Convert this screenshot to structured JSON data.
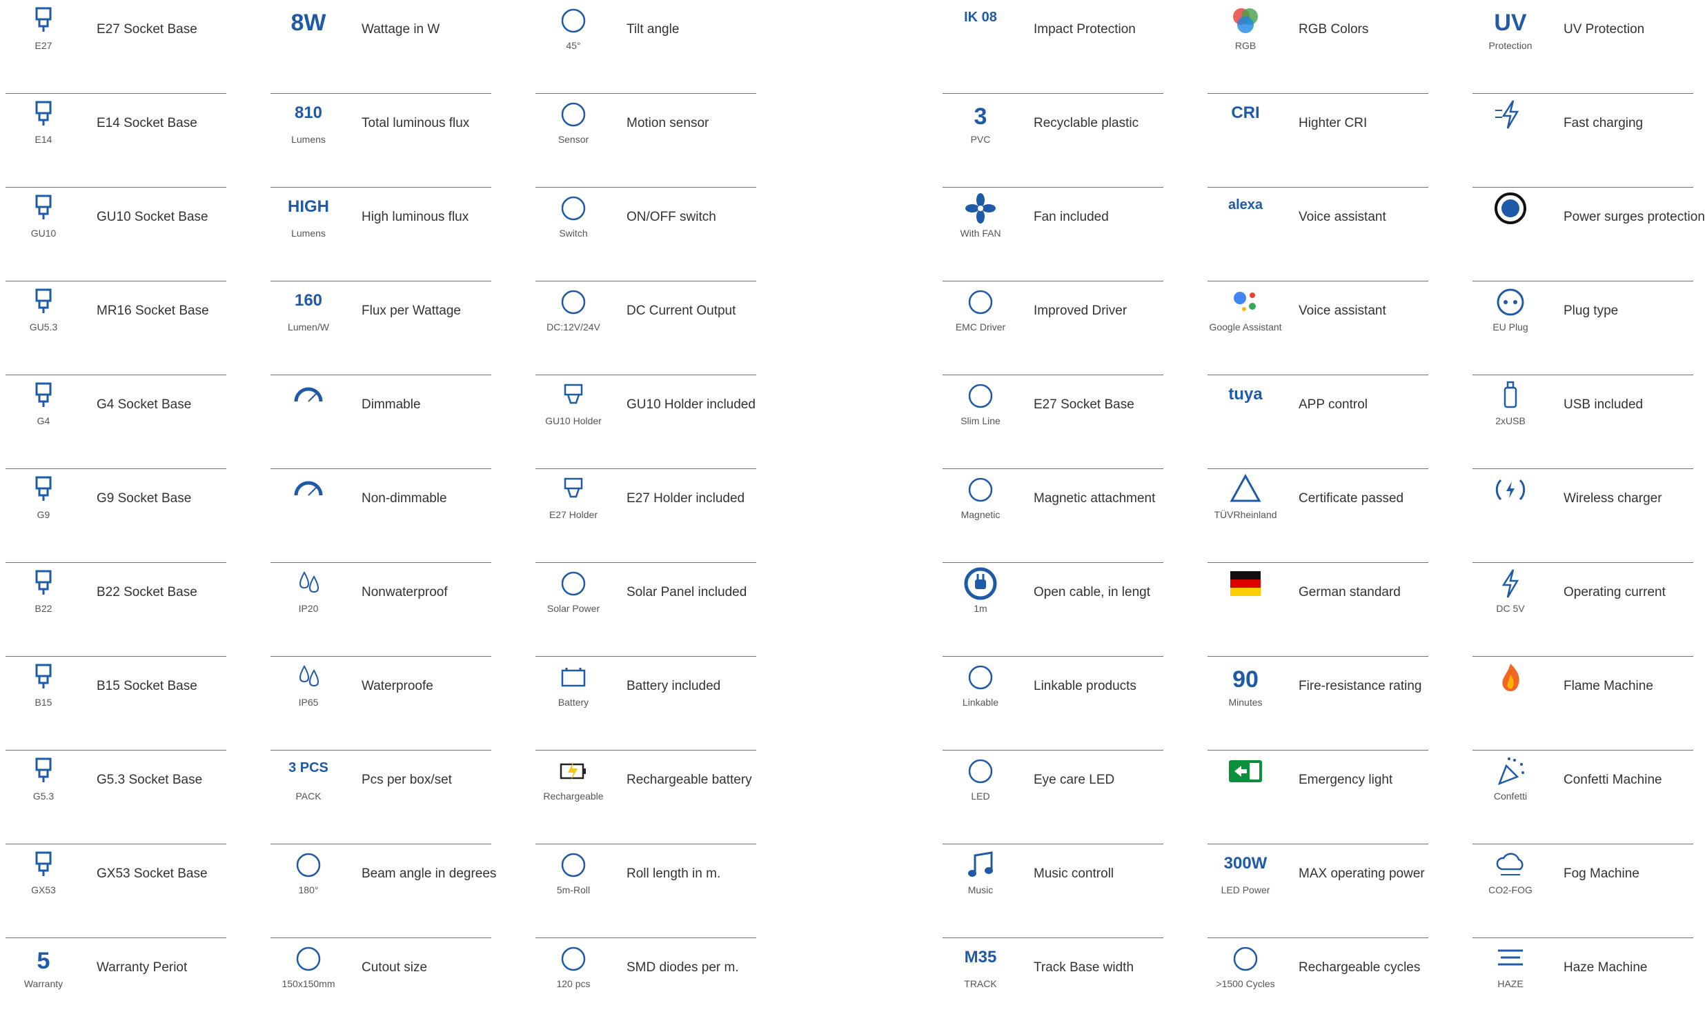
{
  "columns": [
    [
      {
        "icon": "socket-base-icon",
        "sub": "E27",
        "label": "E27 Socket Base"
      },
      {
        "icon": "socket-base-icon",
        "sub": "E14",
        "label": "E14 Socket Base"
      },
      {
        "icon": "socket-base-icon",
        "sub": "GU10",
        "label": "GU10 Socket Base"
      },
      {
        "icon": "socket-base-icon",
        "sub": "GU5.3",
        "label": "MR16 Socket Base"
      },
      {
        "icon": "socket-base-icon",
        "sub": "G4",
        "label": "G4 Socket Base"
      },
      {
        "icon": "socket-base-icon",
        "sub": "G9",
        "label": "G9 Socket Base"
      },
      {
        "icon": "socket-base-icon",
        "sub": "B22",
        "label": "B22 Socket Base"
      },
      {
        "icon": "socket-base-icon",
        "sub": "B15",
        "label": "B15 Socket Base"
      },
      {
        "icon": "socket-base-icon",
        "sub": "G5.3",
        "label": "G5.3 Socket Base"
      },
      {
        "icon": "socket-base-icon",
        "sub": "GX53",
        "label": "GX53 Socket Base"
      },
      {
        "icon": "warranty-icon",
        "big": "5",
        "sub": "Warranty",
        "label": "Warranty Periot"
      }
    ],
    [
      {
        "icon": "wattage-icon",
        "big": "8W",
        "label": "Wattage in W"
      },
      {
        "icon": "sun-icon",
        "big": "810",
        "sub": "Lumens",
        "label": "Total luminous flux"
      },
      {
        "icon": "sun-icon",
        "big": "HIGH",
        "sub": "Lumens",
        "label": "High luminous flux"
      },
      {
        "icon": "sun-icon",
        "big": "160",
        "sub": "Lumen/W",
        "label": "Flux per Wattage"
      },
      {
        "icon": "dimmer-icon",
        "label": "Dimmable"
      },
      {
        "icon": "dimmer-icon",
        "label": "Non-dimmable"
      },
      {
        "icon": "drop-icon",
        "sub": "IP20",
        "label": "Nonwaterproof"
      },
      {
        "icon": "drop-icon",
        "sub": "IP65",
        "label": "Waterproofe"
      },
      {
        "icon": "box-icon",
        "big": "3 PCS",
        "sub": "PACK",
        "label": "Pcs per box/set"
      },
      {
        "icon": "beam-angle-icon",
        "sub": "180°",
        "label": "Beam angle in degrees"
      },
      {
        "icon": "cutout-icon",
        "sub": "150x150mm",
        "label": "Cutout size"
      }
    ],
    [
      {
        "icon": "tilt-icon",
        "sub": "45°",
        "label": "Tilt angle"
      },
      {
        "icon": "motion-sensor-icon",
        "sub": "Sensor",
        "label": "Motion sensor"
      },
      {
        "icon": "switch-icon",
        "sub": "Switch",
        "label": "ON/OFF switch"
      },
      {
        "icon": "dc-icon",
        "sub": "DC:12V/24V",
        "label": "DC Current Output"
      },
      {
        "icon": "holder-icon",
        "sub": "GU10 Holder",
        "label": "GU10 Holder included"
      },
      {
        "icon": "holder-icon",
        "sub": "E27 Holder",
        "label": "E27 Holder included"
      },
      {
        "icon": "solar-icon",
        "sub": "Solar Power",
        "label": "Solar Panel included"
      },
      {
        "icon": "battery-icon",
        "sub": "Battery",
        "label": "Battery included"
      },
      {
        "icon": "battery-charge-icon",
        "sub": "Rechargeable",
        "label": "Rechargeable battery"
      },
      {
        "icon": "roll-icon",
        "sub": "5m-Roll",
        "label": "Roll length in m."
      },
      {
        "icon": "smd-icon",
        "sub": "120 pcs",
        "label": "SMD diodes per m."
      }
    ],
    [
      {
        "icon": "ik08-icon",
        "big": "IK 08",
        "label": "Impact Protection"
      },
      {
        "icon": "recycle-icon",
        "big": "3",
        "sub": "PVC",
        "label": "Recyclable plastic"
      },
      {
        "icon": "fan-icon",
        "sub": "With FAN",
        "label": "Fan included"
      },
      {
        "icon": "driver-icon",
        "sub": "EMC Driver",
        "label": "Improved Driver"
      },
      {
        "icon": "slim-icon",
        "sub": "Slim Line",
        "label": "E27 Socket Base"
      },
      {
        "icon": "magnet-icon",
        "sub": "Magnetic",
        "label": "Magnetic attachment"
      },
      {
        "icon": "plug-icon",
        "sub": "1m",
        "label": "Open cable, in lengt"
      },
      {
        "icon": "connector-icon",
        "sub": "Linkable",
        "label": "Linkable products"
      },
      {
        "icon": "eye-icon",
        "sub": "LED",
        "label": "Eye care LED"
      },
      {
        "icon": "music-icon",
        "sub": "Music",
        "label": "Music controll"
      },
      {
        "icon": "track-icon",
        "big": "M35",
        "sub": "TRACK",
        "label": "Track Base width"
      }
    ],
    [
      {
        "icon": "rgb-icon",
        "sub": "RGB",
        "label": "RGB Colors"
      },
      {
        "icon": "cri-icon",
        "big": "CRI",
        "label": "Highter CRI"
      },
      {
        "icon": "alexa-icon",
        "big": "alexa",
        "label": "Voice assistant"
      },
      {
        "icon": "google-assistant-icon",
        "sub": "Google Assistant",
        "label": "Voice assistant"
      },
      {
        "icon": "tuya-icon",
        "big": "tuya",
        "label": "APP control"
      },
      {
        "icon": "tuv-icon",
        "sub": "TÜVRheinland",
        "label": "Certificate passed"
      },
      {
        "icon": "german-flag-icon",
        "label": "German standard"
      },
      {
        "icon": "fire-icon",
        "big": "90",
        "sub": "Minutes",
        "label": "Fire-resistance rating"
      },
      {
        "icon": "exit-icon",
        "label": "Emergency light"
      },
      {
        "icon": "power-icon",
        "big": "300W",
        "sub": "LED Power",
        "label": "MAX operating power"
      },
      {
        "icon": "battery-cycle-icon",
        "sub": ">1500 Cycles",
        "label": "Rechargeable cycles"
      }
    ],
    [
      {
        "icon": "uv-icon",
        "big": "UV",
        "sub": "Protection",
        "label": "UV Protection"
      },
      {
        "icon": "fast-charge-icon",
        "label": "Fast charging"
      },
      {
        "icon": "surge-icon",
        "label": "Power surges protection"
      },
      {
        "icon": "eu-plug-icon",
        "sub": "EU Plug",
        "label": "Plug type"
      },
      {
        "icon": "usb-icon",
        "sub": "2xUSB",
        "label": "USB included"
      },
      {
        "icon": "wireless-icon",
        "label": "Wireless charger"
      },
      {
        "icon": "bolt-icon",
        "sub": "DC 5V",
        "label": "Operating current"
      },
      {
        "icon": "flame-icon",
        "label": "Flame Machine"
      },
      {
        "icon": "confetti-icon",
        "sub": "Confetti",
        "label": "Confetti Machine"
      },
      {
        "icon": "cloud-icon",
        "sub": "CO2-FOG",
        "label": "Fog Machine"
      },
      {
        "icon": "haze-icon",
        "sub": "HAZE",
        "label": "Haze Machine"
      }
    ]
  ],
  "colors": {
    "accent": "#1e5aa8",
    "divider": "#4a78b0",
    "text": "#333333",
    "sub": "#555555"
  }
}
